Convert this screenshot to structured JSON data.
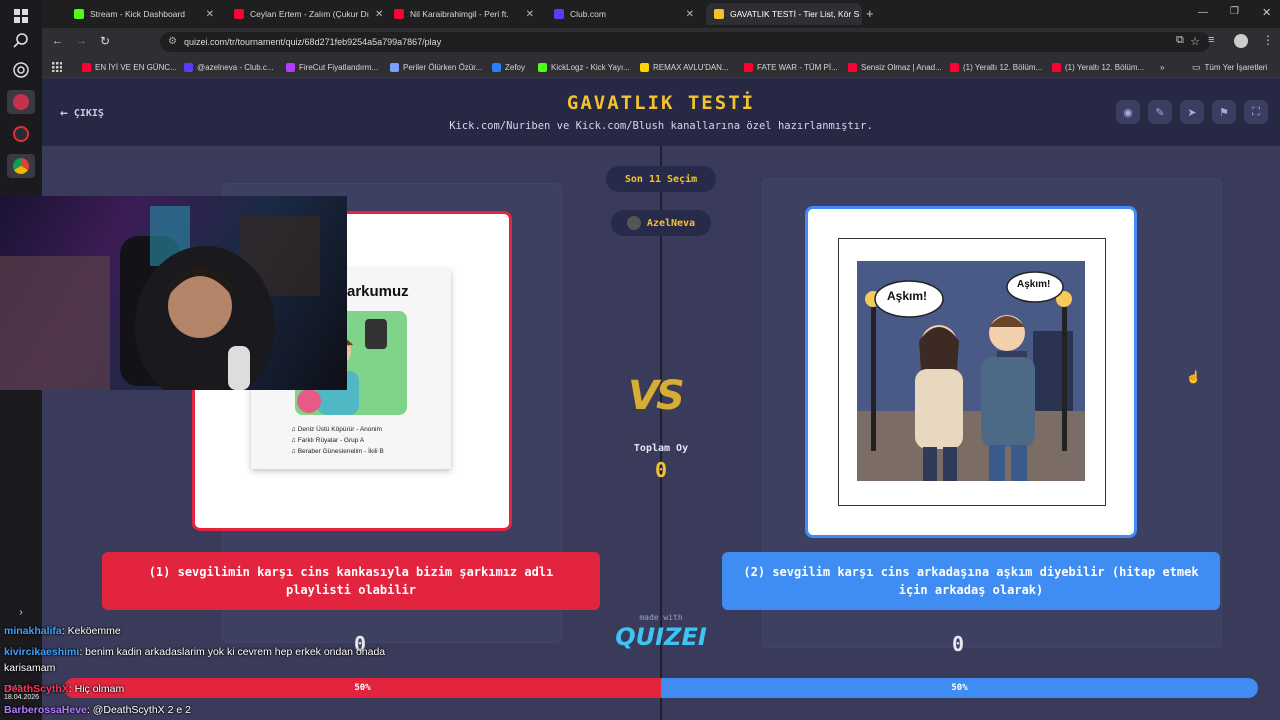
{
  "browser": {
    "tabs": [
      {
        "label": "Stream - Kick Dashboard",
        "color": "#53fc18"
      },
      {
        "label": "Ceylan Ertem - Zalım (Çukur Dı",
        "color": "#ff0033"
      },
      {
        "label": "Nil Karaibrahimgil - Peri ft.",
        "color": "#ff0033"
      },
      {
        "label": "Club.com",
        "color": "#5b3bff"
      },
      {
        "label": "GAVATLIK TESTİ - Tier List, Kör S",
        "color": "#f2c22f"
      }
    ],
    "url": "quizei.com/tr/tournament/quiz/68d271feb9254a5a799a7867/play",
    "bookmarks": [
      {
        "label": "EN İYİ VE EN GÜNC...",
        "color": "#ff0033"
      },
      {
        "label": "@azelneva - Club.c...",
        "color": "#5b3bff"
      },
      {
        "label": "FireCut Fiyatlandırm...",
        "color": "#b13bff"
      },
      {
        "label": "Periler Ölürken Özür...",
        "color": "#7aa0ff"
      },
      {
        "label": "Zefoy",
        "color": "#2e7dff"
      },
      {
        "label": "KickLogz - Kick Yayı...",
        "color": "#53fc18"
      },
      {
        "label": "REMAX AVLU'DAN...",
        "color": "#ffd400"
      },
      {
        "label": "FATE WAR - TÜM Pİ...",
        "color": "#ff0033"
      },
      {
        "label": "Sensiz Olmaz | Anad...",
        "color": "#ff0033"
      },
      {
        "label": "(1) Yeraltı 12. Bölüm...",
        "color": "#ff0033"
      },
      {
        "label": "(1) Yeraltı 12. Bölüm...",
        "color": "#ff0033"
      }
    ],
    "all_bookmarks": "Tüm Yer İşaretleri"
  },
  "quiz": {
    "exit_label": "ÇIKIŞ",
    "title": "GAVATLIK TESTİ",
    "subtitle": "Kick.com/Nuriben ve Kick.com/Blush kanallarına özel hazırlanmıştır.",
    "round_label": "Son 11 Seçim",
    "user": "AzelNeva",
    "vs": "VS",
    "total_label": "Toplam Oy",
    "total_value": "0",
    "left": {
      "choice": "(1) sevgilimin karşı cins kankasıyla bizim şarkımız adlı playlisti olabilir",
      "count": "0",
      "percent": "50%",
      "image_title": "arkumuz",
      "songs": [
        "Deniz Üstü Köpürür - Anonim",
        "Farklı Rüyalar - Grup A",
        "Beraber Güneslenelim - İkili B"
      ]
    },
    "right": {
      "choice": "(2) sevgilim karşı cins arkadaşına aşkım diyebilir (hitap etmek için arkadaş olarak)",
      "count": "0",
      "percent": "50%",
      "bubble_left": "Aşkım!",
      "bubble_right": "Aşkım!"
    },
    "made_with": "made with",
    "logo": "QUIZEI",
    "accent": "#f2c22f",
    "red": "#e2243f",
    "blue": "#3f8cf2"
  },
  "chat": [
    {
      "user": "minakhalifa",
      "message": ": Keköemme",
      "color": "#3fa2ff"
    },
    {
      "user": "kivircikaeshimi",
      "message": ": benim kadin arkadaslarim yok ki cevrem hep erkek ondan onada",
      "color": "#3fa2ff"
    },
    {
      "user": "",
      "message": "karisamam",
      "color": "#ffffff"
    },
    {
      "user": "DeathScythX",
      "message": ": Hiç olmam",
      "color": "#ff3355"
    },
    {
      "user": "BarberossaHeve",
      "message": ": @DeathScythX 2 e 2",
      "color": "#b07cff"
    }
  ],
  "clock": {
    "time": "19:13",
    "date": "18.04.2026"
  }
}
